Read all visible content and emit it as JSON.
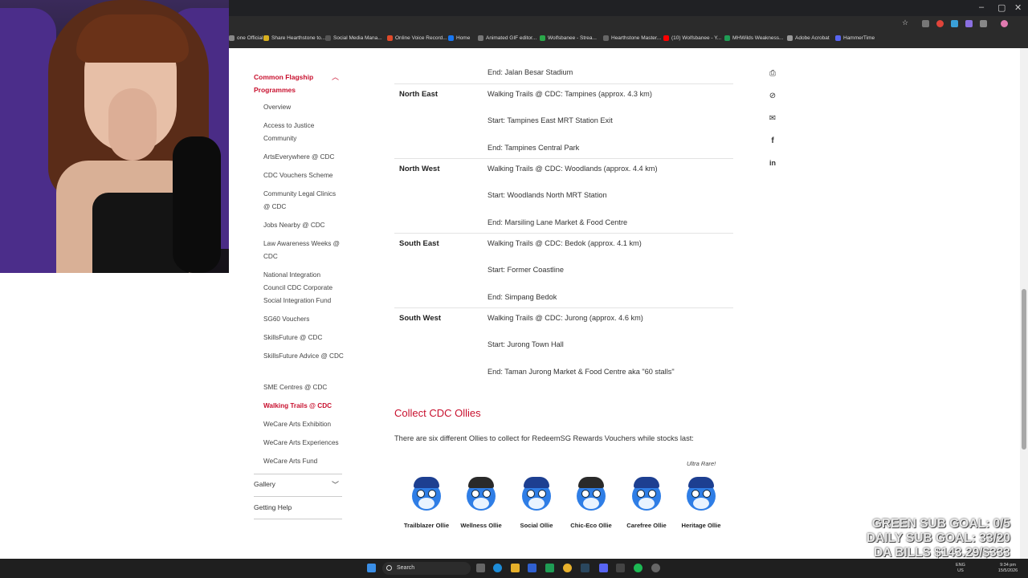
{
  "browser": {
    "bookmarks": [
      {
        "label": "one Official...",
        "color": "#888"
      },
      {
        "label": "Share Hearthstone to...",
        "color": "#d8b020"
      },
      {
        "label": "Social Media Mana...",
        "color": "#555"
      },
      {
        "label": "Online Voice Record...",
        "color": "#e04a2a"
      },
      {
        "label": "Home",
        "color": "#1877f2"
      },
      {
        "label": "Animated GIF editor...",
        "color": "#777"
      },
      {
        "label": "Wolfsbanee - Strea...",
        "color": "#2aa84a"
      },
      {
        "label": "Hearthstone Master...",
        "color": "#666"
      },
      {
        "label": "(10) Wolfsbanee - Y...",
        "color": "#ff0000"
      },
      {
        "label": "MHWilds Weakness...",
        "color": "#1f9d55"
      },
      {
        "label": "Adobe Acrobat",
        "color": "#999"
      },
      {
        "label": "HammerTime",
        "color": "#5865f2"
      }
    ]
  },
  "sidebar": {
    "heading": "Common Flagship Programmes",
    "items": [
      "Overview",
      "Access to Justice Community",
      "ArtsEverywhere @ CDC",
      "CDC Vouchers Scheme",
      "Community Legal Clinics @ CDC",
      "Jobs Nearby @ CDC",
      "Law Awareness Weeks @ CDC",
      "National Integration Council CDC Corporate Social Integration Fund",
      "SG60 Vouchers",
      "SkillsFuture @ CDC",
      "SkillsFuture Advice @ CDC",
      "SME Centres @ CDC",
      "Walking Trails @ CDC",
      "WeCare Arts Exhibition",
      "WeCare Arts Experiences",
      "WeCare Arts Fund"
    ],
    "gallery": "Gallery",
    "getting_help": "Getting Help"
  },
  "table": {
    "top_end": "End: Jalan Besar Stadium",
    "rows": [
      {
        "region": "North East",
        "trail": "Walking Trails @ CDC: Tampines (approx. 4.3 km)",
        "start": "Start: Tampines East MRT Station Exit",
        "end": "End: Tampines Central Park"
      },
      {
        "region": "North West",
        "trail": "Walking Trails @ CDC: Woodlands (approx. 4.4 km)",
        "start": "Start: Woodlands North MRT Station",
        "end": "End: Marsiling Lane Market & Food Centre"
      },
      {
        "region": "South East",
        "trail": "Walking Trails @ CDC: Bedok (approx. 4.1 km)",
        "start": "Start: Former Coastline",
        "end": "End: Simpang Bedok"
      },
      {
        "region": "South West",
        "trail": "Walking Trails @ CDC: Jurong (approx. 4.6 km)",
        "start": "Start: Jurong Town Hall",
        "end": "End: Taman Jurong Market & Food Centre aka \"60 stalls\""
      }
    ]
  },
  "share_icons": [
    "print-icon",
    "link-icon",
    "mail-icon",
    "facebook-icon",
    "linkedin-icon"
  ],
  "ollies_section": {
    "title": "Collect CDC Ollies",
    "text": "There are six different Ollies to collect for RedeemSG Rewards Vouchers while stocks last:",
    "ultra_rare": "Ultra Rare!",
    "ollies": [
      "Trailblazer Ollie",
      "Wellness Ollie",
      "Social Ollie",
      "Chic-Eco Ollie",
      "Carefree Ollie",
      "Heritage Ollie"
    ]
  },
  "overlay": {
    "green_goal": "GREEN SUB GOAL: 0/5",
    "daily_goal": "DAILY SUB GOAL: 33/20",
    "bills": "DA BILLS $143.29/$333"
  },
  "taskbar": {
    "search": "Search",
    "lang_top": "ENG",
    "lang_bottom": "US",
    "time": "9:34 pm",
    "date": "15/5/2026"
  },
  "colors": {
    "accent": "#c8102e",
    "taskbar": "#1f1f1f"
  }
}
